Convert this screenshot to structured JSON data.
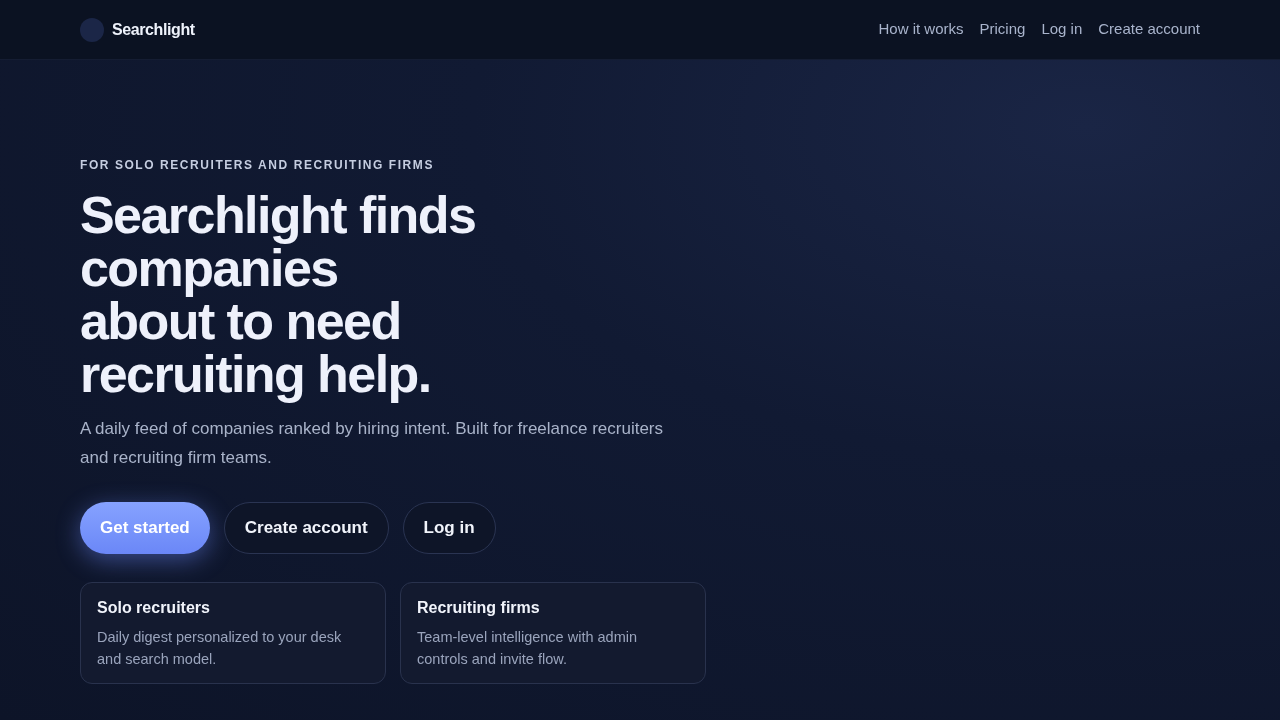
{
  "brand": {
    "name": "Searchlight"
  },
  "nav": {
    "links": [
      "How it works",
      "Pricing",
      "Log in",
      "Create account"
    ]
  },
  "hero": {
    "eyebrow": "FOR SOLO RECRUITERS AND RECRUITING FIRMS",
    "headline": "Searchlight finds\ncompanies\nabout to need\nrecruiting help.",
    "description": "A daily feed of companies ranked by hiring intent. Built for freelance recruiters and recruiting firm teams.",
    "buttons": [
      {
        "label": "Get started",
        "kind": "primary"
      },
      {
        "label": "Create account",
        "kind": "outline"
      },
      {
        "label": "Log in",
        "kind": "outline"
      }
    ],
    "cards": [
      {
        "title": "Solo recruiters",
        "text": "Daily digest personalized to your desk and search model."
      },
      {
        "title": "Recruiting firms",
        "text": "Team-level intelligence with admin controls and invite flow."
      }
    ]
  }
}
